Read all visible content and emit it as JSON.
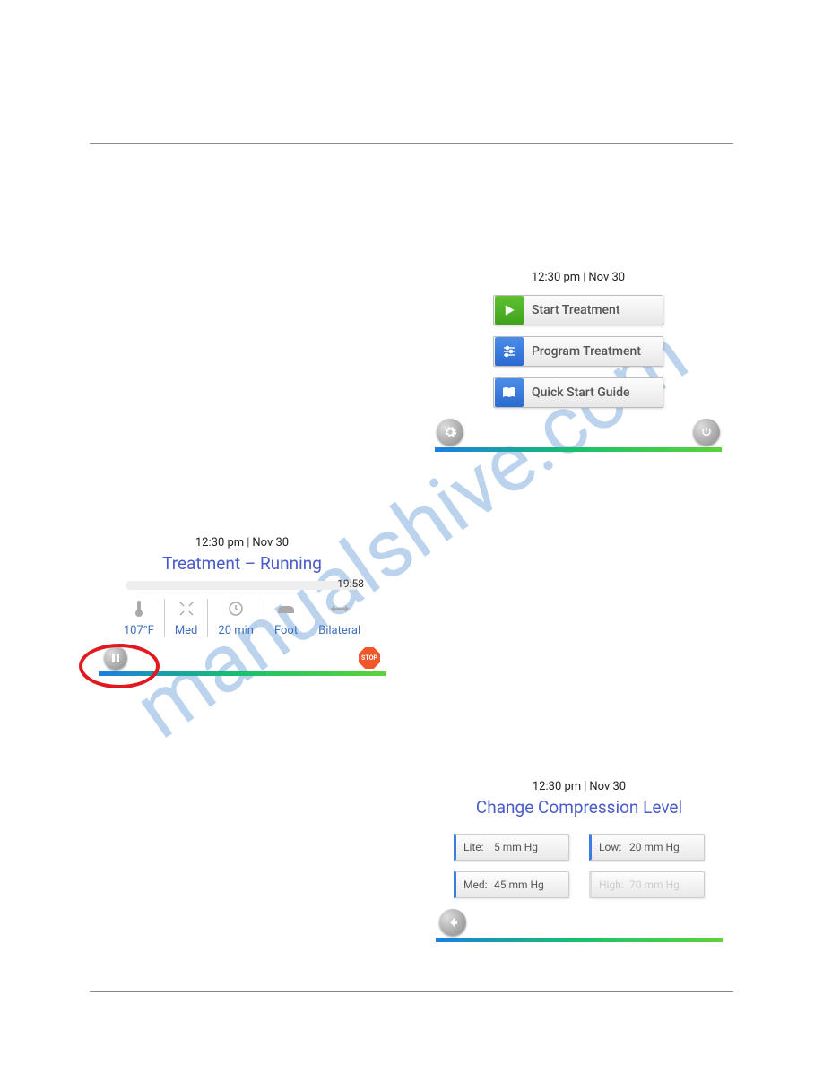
{
  "watermark": "manualshive.com",
  "timestamp": {
    "time": "12:30 pm",
    "date": "Nov  30"
  },
  "homePanel": {
    "buttons": [
      {
        "label": "Start Treatment"
      },
      {
        "label": "Program Treatment"
      },
      {
        "label": "Quick Start Guide"
      }
    ]
  },
  "runningPanel": {
    "title": "Treatment – Running",
    "elapsed": "19:58",
    "params": {
      "temp": "107°F",
      "compression": "Med",
      "duration": "20 min",
      "wrap": "Foot",
      "mode": "Bilateral"
    },
    "stopLabel": "STOP"
  },
  "compressionPanel": {
    "title": "Change Compression Level",
    "options": [
      {
        "name": "Lite:",
        "value": "5 mm Hg",
        "disabled": false
      },
      {
        "name": "Low:",
        "value": "20 mm Hg",
        "disabled": false
      },
      {
        "name": "Med:",
        "value": "45 mm Hg",
        "disabled": false
      },
      {
        "name": "High:",
        "value": "70 mm Hg",
        "disabled": true
      }
    ]
  }
}
